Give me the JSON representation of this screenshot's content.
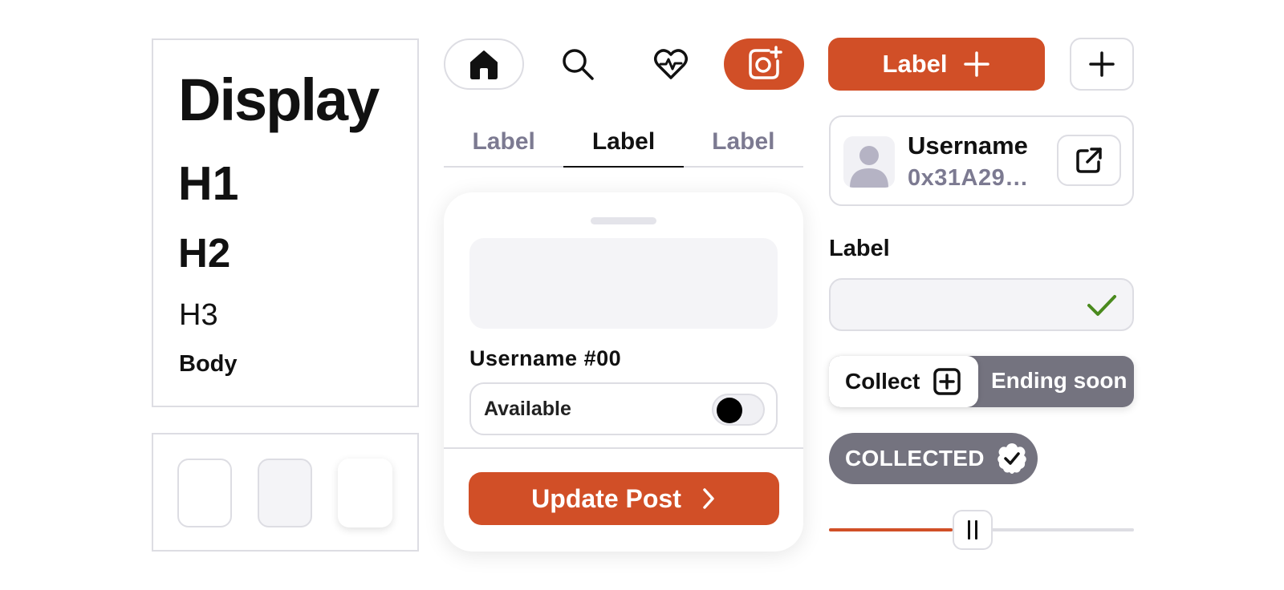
{
  "typography": {
    "display": "Display",
    "h1": "H1",
    "h2": "H2",
    "h3": "H3",
    "body": "Body"
  },
  "nav": {
    "icons": [
      "home-icon",
      "search-icon",
      "heart-pulse-icon",
      "camera-plus-icon"
    ],
    "active_color": "#d14f27"
  },
  "tabs": [
    {
      "label": "Label",
      "active": false
    },
    {
      "label": "Label",
      "active": true
    },
    {
      "label": "Label",
      "active": false
    }
  ],
  "sheet": {
    "username": "Username #00",
    "availability_label": "Available",
    "toggle_on": false,
    "update_button": "Update Post"
  },
  "actions": {
    "label_button": "Label"
  },
  "user_card": {
    "name": "Username",
    "address": "0x31A29…"
  },
  "field": {
    "label": "Label",
    "value": "",
    "valid": true
  },
  "collect": {
    "button": "Collect",
    "status": "Ending soon"
  },
  "collected_badge": "COLLECTED",
  "slider": {
    "value": 0.47
  },
  "colors": {
    "accent": "#d14f27",
    "muted": "#7c7a91",
    "badge": "#74737f",
    "success": "#4a8a1e"
  }
}
